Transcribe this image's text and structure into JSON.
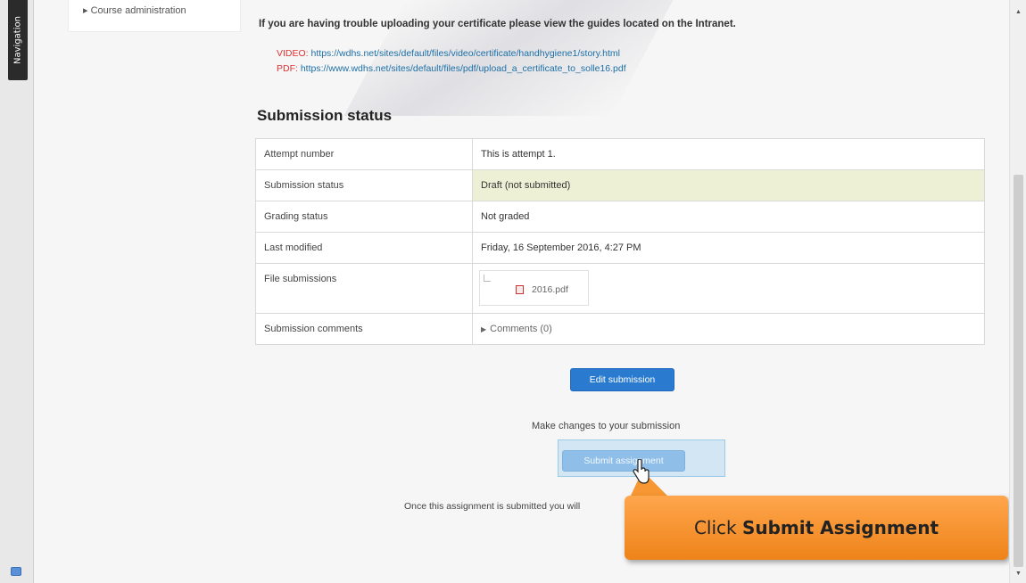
{
  "nav": {
    "tab_label": "Navigation"
  },
  "course_admin": {
    "label": "▸ Course administration"
  },
  "intro": {
    "text": "If you are having trouble uploading your certificate please view the guides located on the Intranet."
  },
  "guides": {
    "video_label": "VIDEO:",
    "video_url": "https://wdhs.net/sites/default/files/video/certificate/handhygiene1/story.html",
    "pdf_label": "PDF:",
    "pdf_url": "https://www.wdhs.net/sites/default/files/pdf/upload_a_certificate_to_solle16.pdf"
  },
  "section_title": "Submission status",
  "table": {
    "attempt": {
      "label": "Attempt number",
      "value": "This is attempt 1."
    },
    "submission_status": {
      "label": "Submission status",
      "value": "Draft (not submitted)"
    },
    "grading": {
      "label": "Grading status",
      "value": "Not graded"
    },
    "modified": {
      "label": "Last modified",
      "value": "Friday, 16 September 2016, 4:27 PM"
    },
    "files": {
      "label": "File submissions",
      "file_name": "2016.pdf"
    },
    "comments": {
      "label": "Submission comments",
      "value": "Comments (0)"
    }
  },
  "actions": {
    "edit_label": "Edit submission",
    "edit_hint": "Make changes to your submission",
    "submit_label": "Submit assignment",
    "submit_hint": "Once this assignment is submitted you will"
  },
  "callout": {
    "prefix": "Click ",
    "bold": "Submit Assignment"
  },
  "colors": {
    "accent": "#2a7bd0",
    "callout": "#ee8319",
    "draft_bg": "#eef0d6"
  }
}
